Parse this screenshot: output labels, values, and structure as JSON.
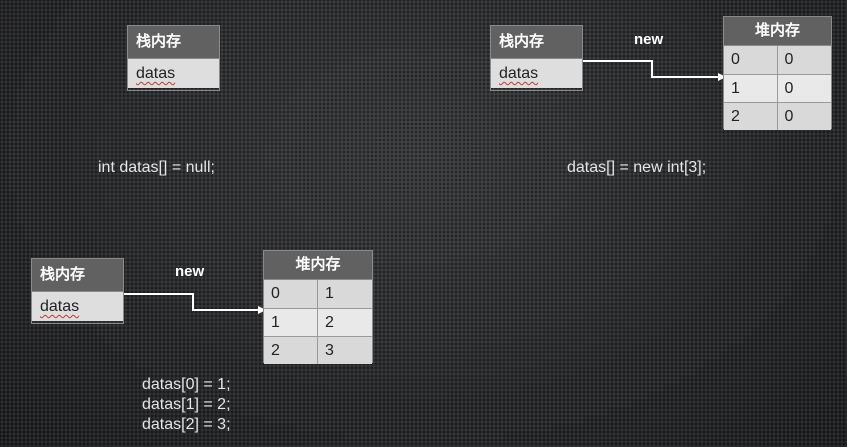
{
  "diagrams": [
    {
      "stack_header": "栈内存",
      "stack_var": "datas",
      "code": [
        "int datas[] = null;"
      ]
    },
    {
      "stack_header": "栈内存",
      "stack_var": "datas",
      "arrow_label": "new",
      "heap_header": "堆内存",
      "heap_rows": [
        [
          "0",
          "0"
        ],
        [
          "1",
          "0"
        ],
        [
          "2",
          "0"
        ]
      ],
      "code": [
        "datas[] = new int[3];"
      ]
    },
    {
      "stack_header": "栈内存",
      "stack_var": "datas",
      "arrow_label": "new",
      "heap_header": "堆内存",
      "heap_rows": [
        [
          "0",
          "1"
        ],
        [
          "1",
          "2"
        ],
        [
          "2",
          "3"
        ]
      ],
      "code": [
        "datas[0] = 1;",
        "datas[1] = 2;",
        "datas[2] = 3;"
      ]
    }
  ],
  "colors": {
    "header_bg": "#616161",
    "cell_bg": "#dedede",
    "arrow": "#ffffff",
    "background": "#2b2c2e"
  }
}
